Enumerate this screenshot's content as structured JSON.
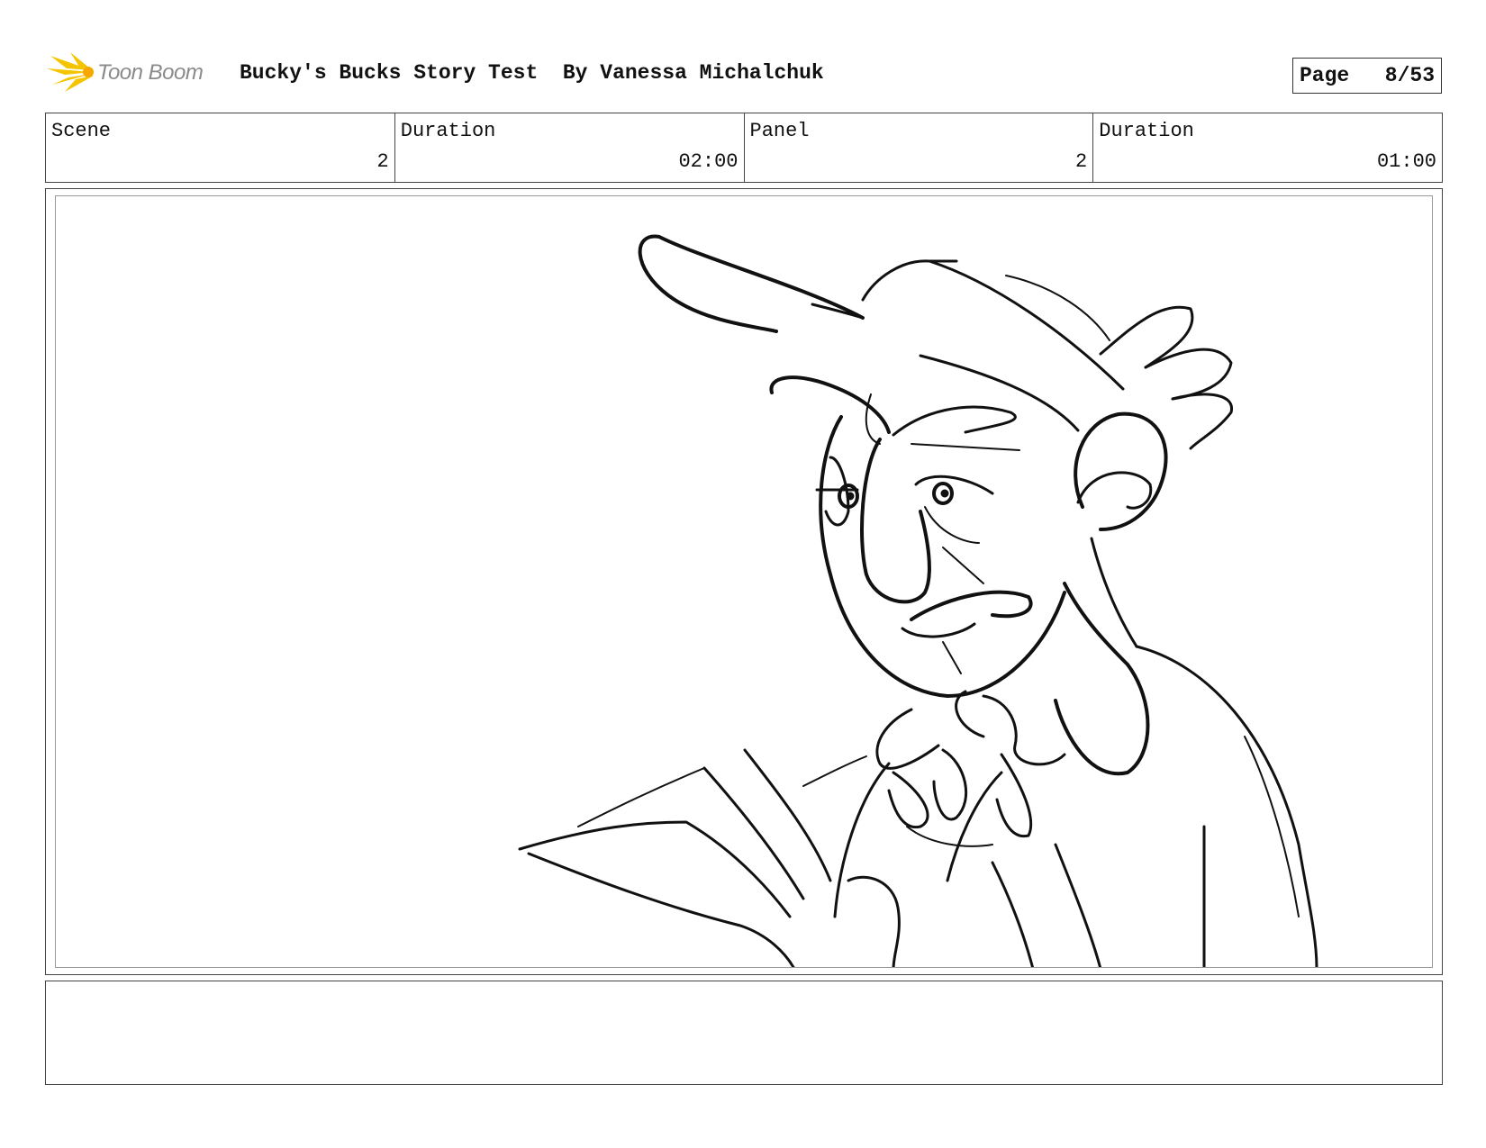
{
  "header": {
    "logo_text": "Toon Boom",
    "title": "Bucky's Bucks Story Test  By Vanessa Michalchuk"
  },
  "page": {
    "label": "Page",
    "number": "8/53"
  },
  "info": {
    "scene_label": "Scene",
    "scene_value": "2",
    "scene_duration_label": "Duration",
    "scene_duration_value": "02:00",
    "panel_label": "Panel",
    "panel_value": "2",
    "panel_duration_label": "Duration",
    "panel_duration_value": "01:00"
  },
  "panel": {
    "image": "storyboard-sketch-character-reading"
  },
  "notes": {
    "text": ""
  },
  "colors": {
    "logo_yellow": "#f5c400",
    "logo_gray": "#8a8a8a",
    "border": "#444444"
  }
}
